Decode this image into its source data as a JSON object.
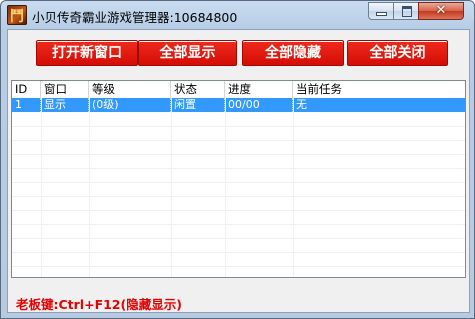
{
  "window": {
    "icon_glyph": "鬥",
    "title": "小贝传奇霸业游戏管理器:10684800",
    "close_glyph": "✕"
  },
  "toolbar": {
    "buttons": [
      {
        "label": "打开新窗口"
      },
      {
        "label": "全部显示"
      },
      {
        "label": "全部隐藏"
      },
      {
        "label": "全部关闭"
      }
    ]
  },
  "table": {
    "columns": [
      "ID",
      "窗口",
      "等级",
      "状态",
      "进度",
      "当前任务"
    ],
    "rows": [
      {
        "id": "1",
        "window": "显示",
        "level": "(0级)",
        "status": "闲置",
        "progress": "00/00",
        "task": "无",
        "selected": true
      }
    ]
  },
  "footer": {
    "hotkey_text": "老板键:Ctrl+F12(隐藏显示)"
  },
  "colors": {
    "button_red": "#d40d05",
    "selection_blue": "#3399ff",
    "hotkey_red": "#e60000"
  }
}
